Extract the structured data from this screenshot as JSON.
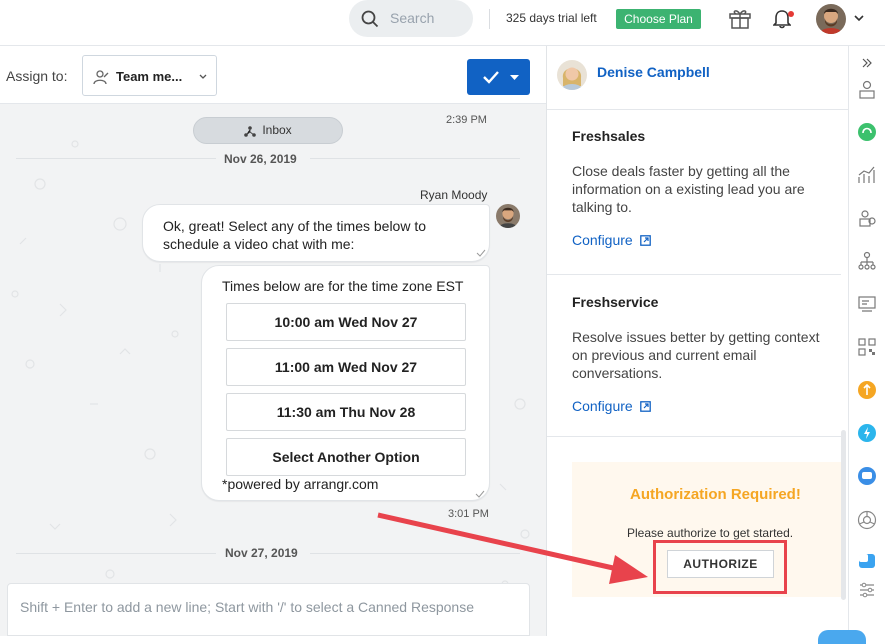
{
  "topbar": {
    "search_placeholder": "Search",
    "trial_text": "325 days trial left",
    "choose_plan_label": "Choose Plan"
  },
  "assign": {
    "label": "Assign to:",
    "team_value": "Team me..."
  },
  "chat": {
    "pill_label": "Inbox",
    "time_top": "2:39 PM",
    "date1": "Nov 26, 2019",
    "sender": "Ryan Moody",
    "message1": "Ok, great! Select any of the times below to schedule a video chat with me:",
    "timezone_header": "Times below are for the time zone EST",
    "options": [
      "10:00 am Wed Nov 27",
      "11:00 am Wed Nov 27",
      "11:30 am Thu Nov 28",
      "Select Another Option"
    ],
    "powered_by": "*powered by arrangr.com",
    "time_bottom": "3:01 PM",
    "date2": "Nov 27, 2019",
    "composer_placeholder": "Shift + Enter to add a new line; Start with '/' to select a Canned Response"
  },
  "contact": {
    "name": "Denise Campbell"
  },
  "apps": [
    {
      "title": "Freshsales",
      "desc": "Close deals faster by getting all the information on a existing lead you are talking to.",
      "link": "Configure"
    },
    {
      "title": "Freshservice",
      "desc": "Resolve issues better by getting context on previous and current email conversations.",
      "link": "Configure"
    }
  ],
  "auth": {
    "title": "Authorization Required!",
    "subtitle": "Please authorize to get started.",
    "button": "AUTHORIZE"
  },
  "colors": {
    "brand_blue": "#1162c4",
    "choose_plan_green": "#3cb371",
    "auth_orange": "#f5a623",
    "annotation_red": "#e8434c"
  },
  "icons": [
    "search-icon",
    "gift-icon",
    "bell-icon",
    "chevron-down-icon",
    "team-icon",
    "check-icon",
    "inbox-icon",
    "external-link-icon",
    "double-chevron-right-icon"
  ]
}
